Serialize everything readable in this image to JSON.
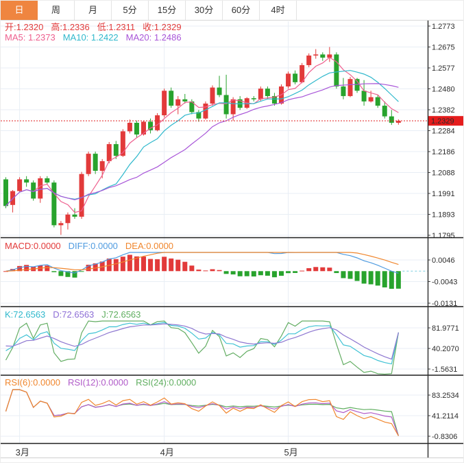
{
  "tabs": {
    "items": [
      {
        "id": "day",
        "label": "日",
        "active": true
      },
      {
        "id": "week",
        "label": "周",
        "active": false
      },
      {
        "id": "month",
        "label": "月",
        "active": false
      },
      {
        "id": "5min",
        "label": "5分",
        "active": false
      },
      {
        "id": "15min",
        "label": "15分",
        "active": false
      },
      {
        "id": "30min",
        "label": "30分",
        "active": false
      },
      {
        "id": "60min",
        "label": "60分",
        "active": false
      },
      {
        "id": "4hour",
        "label": "4时",
        "active": false
      }
    ]
  },
  "info": {
    "open": "开:1.2320",
    "high": "高:1.2336",
    "low": "低:1.2311",
    "close": "收:1.2329",
    "ma5": "MA5: 1.2373",
    "ma10": "MA10: 1.2422",
    "ma20": "MA20: 1.2486"
  },
  "main_axis": {
    "labels": [
      "1.2773",
      "1.2675",
      "1.2577",
      "1.2480",
      "1.2382",
      "1.2284",
      "1.2186",
      "1.2088",
      "1.1991",
      "1.1893",
      "1.1795"
    ],
    "price_tag": "1.2329"
  },
  "panels": {
    "macd": {
      "label_macd": "MACD:0.0000",
      "label_diff": "DIFF:0.0000",
      "label_dea": "DEA:0.0000",
      "axis_labels": [
        "0.0046",
        "-0.0043",
        "-0.0131"
      ]
    },
    "kdj": {
      "label_k": "K:72.6563",
      "label_d": "D:72.6563",
      "label_j": "J:72.6563",
      "axis_labels": [
        "81.9771",
        "40.2070",
        "-1.5631"
      ]
    },
    "rsi": {
      "label_rsi6": "RSI(6):0.0000",
      "label_rsi12": "RSI(12):0.0000",
      "label_rsi24": "RSI(24):0.0000",
      "axis_labels": [
        "83.2534",
        "41.2114",
        "-0.8306"
      ]
    }
  },
  "x_axis": {
    "labels": [
      "3月",
      "4月",
      "5月"
    ]
  },
  "colors": {
    "up": "#e23a3a",
    "down": "#28a32d",
    "grid": "#e8eef5",
    "accent_tab": "#ef8540",
    "price_tag_bg": "#e51c1c",
    "price_line": "#e02020",
    "separator": "#1f1f1f",
    "ma5": "#ee5f8e",
    "ma10": "#2fb8cc",
    "ma20": "#a855d8",
    "diff": "#4f9be0",
    "dea": "#f0862d",
    "zero_dash": "#7ccfe0",
    "k": "#3fc2d4",
    "d": "#8d76d0",
    "j": "#63ad63",
    "rsi6": "#f0862d",
    "rsi12": "#b05ac8",
    "rsi24": "#5fae5f"
  },
  "chart_data": {
    "type": "candlestick",
    "title": "日K线 (daily K-line with MACD / KDJ / RSI panels)",
    "last_bar": {
      "open": 1.232,
      "high": 1.2336,
      "low": 1.2311,
      "close": 1.2329
    },
    "ma_readout": {
      "ma5": 1.2373,
      "ma10": 1.2422,
      "ma20": 1.2486
    },
    "current_price": 1.2329,
    "main_axis_ticks": [
      1.2773,
      1.2675,
      1.2577,
      1.248,
      1.2382,
      1.2284,
      1.2186,
      1.2088,
      1.1991,
      1.1893,
      1.1795
    ],
    "month_ticks": [
      {
        "label": "3月",
        "index": 2
      },
      {
        "label": "4月",
        "index": 23
      },
      {
        "label": "5月",
        "index": 41
      }
    ],
    "candles": [
      [
        1.2055,
        1.2065,
        1.192,
        1.193
      ],
      [
        1.1935,
        1.2005,
        1.19,
        1.2
      ],
      [
        1.2,
        1.2065,
        1.1995,
        1.2055
      ],
      [
        1.2055,
        1.207,
        1.202,
        1.204
      ],
      [
        1.204,
        1.205,
        1.1955,
        1.1965
      ],
      [
        1.1965,
        1.207,
        1.1945,
        1.206
      ],
      [
        1.206,
        1.207,
        1.203,
        1.204
      ],
      [
        1.204,
        1.205,
        1.183,
        1.184
      ],
      [
        1.184,
        1.186,
        1.1795,
        1.185
      ],
      [
        1.185,
        1.19,
        1.182,
        1.189
      ],
      [
        1.189,
        1.192,
        1.187,
        1.188
      ],
      [
        1.188,
        1.209,
        1.187,
        1.208
      ],
      [
        1.208,
        1.2185,
        1.207,
        1.2175
      ],
      [
        1.2175,
        1.2185,
        1.208,
        1.2095
      ],
      [
        1.2095,
        1.215,
        1.206,
        1.214
      ],
      [
        1.214,
        1.223,
        1.213,
        1.222
      ],
      [
        1.222,
        1.2235,
        1.215,
        1.2165
      ],
      [
        1.2165,
        1.229,
        1.216,
        1.228
      ],
      [
        1.228,
        1.2335,
        1.227,
        1.232
      ],
      [
        1.232,
        1.233,
        1.225,
        1.2265
      ],
      [
        1.2265,
        1.233,
        1.226,
        1.2325
      ],
      [
        1.2325,
        1.234,
        1.227,
        1.2285
      ],
      [
        1.2285,
        1.2365,
        1.228,
        1.2355
      ],
      [
        1.2355,
        1.248,
        1.2345,
        1.247
      ],
      [
        1.247,
        1.2485,
        1.239,
        1.24
      ],
      [
        1.24,
        1.2445,
        1.236,
        1.243
      ],
      [
        1.243,
        1.2455,
        1.241,
        1.242
      ],
      [
        1.242,
        1.243,
        1.236,
        1.237
      ],
      [
        1.237,
        1.238,
        1.2325,
        1.234
      ],
      [
        1.234,
        1.242,
        1.2335,
        1.241
      ],
      [
        1.241,
        1.2495,
        1.24,
        1.2485
      ],
      [
        1.2485,
        1.254,
        1.244,
        1.245
      ],
      [
        1.245,
        1.2545,
        1.234,
        1.236
      ],
      [
        1.236,
        1.244,
        1.233,
        1.243
      ],
      [
        1.243,
        1.2445,
        1.238,
        1.239
      ],
      [
        1.239,
        1.244,
        1.2385,
        1.2435
      ],
      [
        1.2435,
        1.2445,
        1.242,
        1.243
      ],
      [
        1.243,
        1.249,
        1.242,
        1.248
      ],
      [
        1.248,
        1.249,
        1.243,
        1.2445
      ],
      [
        1.2445,
        1.246,
        1.24,
        1.241
      ],
      [
        1.241,
        1.25,
        1.2405,
        1.249
      ],
      [
        1.249,
        1.256,
        1.248,
        1.255
      ],
      [
        1.255,
        1.2565,
        1.25,
        1.251
      ],
      [
        1.251,
        1.26,
        1.2505,
        1.259
      ],
      [
        1.259,
        1.2645,
        1.258,
        1.2635
      ],
      [
        1.2635,
        1.2665,
        1.262,
        1.264
      ],
      [
        1.264,
        1.265,
        1.261,
        1.2625
      ],
      [
        1.2625,
        1.2675,
        1.2605,
        1.264
      ],
      [
        1.264,
        1.265,
        1.248,
        1.249
      ],
      [
        1.249,
        1.253,
        1.243,
        1.2445
      ],
      [
        1.2445,
        1.2535,
        1.244,
        1.2525
      ],
      [
        1.2525,
        1.253,
        1.246,
        1.247
      ],
      [
        1.247,
        1.252,
        1.24,
        1.242
      ],
      [
        1.242,
        1.247,
        1.2415,
        1.244
      ],
      [
        1.244,
        1.245,
        1.239,
        1.24
      ],
      [
        1.24,
        1.242,
        1.234,
        1.235
      ],
      [
        1.235,
        1.238,
        1.231,
        1.232
      ],
      [
        1.232,
        1.2336,
        1.2311,
        1.2329
      ]
    ],
    "macd": {
      "macd": 0.0,
      "diff": 0.0,
      "dea": 0.0,
      "axis_ticks": [
        0.0046,
        -0.0043,
        -0.0131
      ]
    },
    "kdj": {
      "k": 72.6563,
      "d": 72.6563,
      "j": 72.6563,
      "axis_ticks": [
        81.9771,
        40.207,
        -1.5631
      ]
    },
    "rsi": {
      "rsi6": 0.0,
      "rsi12": 0.0,
      "rsi24": 0.0,
      "axis_ticks": [
        83.2534,
        41.2114,
        -0.8306
      ]
    }
  }
}
